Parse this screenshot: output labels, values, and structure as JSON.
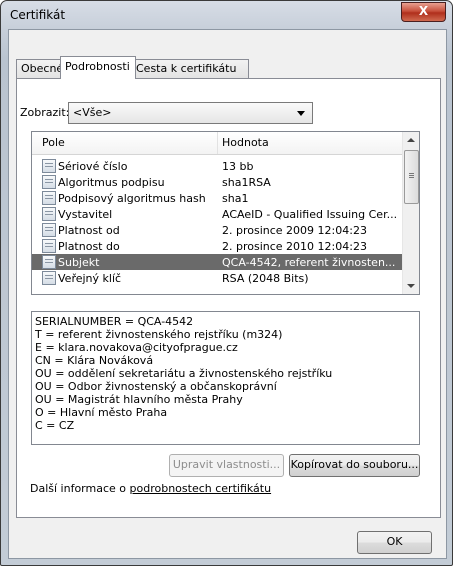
{
  "window": {
    "title": "Certifikát",
    "close_label": "X"
  },
  "tabs": [
    {
      "label": "Obecné",
      "active": false
    },
    {
      "label": "Podrobnosti",
      "active": true
    },
    {
      "label": "Cesta k certifikátu",
      "active": false
    }
  ],
  "show": {
    "label": "Zobrazit:",
    "value": "<Vše>"
  },
  "list": {
    "columns": [
      "Pole",
      "Hodnota"
    ],
    "rows": [
      {
        "field": "Sériové číslo",
        "value": "13 bb"
      },
      {
        "field": "Algoritmus podpisu",
        "value": "sha1RSA"
      },
      {
        "field": "Podpisový algoritmus hash",
        "value": "sha1"
      },
      {
        "field": "Vystavitel",
        "value": "ACAeID - Qualified Issuing Cer..."
      },
      {
        "field": "Platnost od",
        "value": "2. prosince 2009 12:04:23"
      },
      {
        "field": "Platnost do",
        "value": "2. prosince 2010 12:04:23"
      },
      {
        "field": "Subjekt",
        "value": "QCA-4542, referent živnosten..."
      },
      {
        "field": "Veřejný klíč",
        "value": "RSA (2048 Bits)"
      }
    ],
    "selected_index": 6
  },
  "detail_lines": [
    "SERIALNUMBER = QCA-4542",
    "T = referent živnostenského rejstříku (m324)",
    "E = klara.novakova@cityofprague.cz",
    "CN = Klára Nováková",
    "OU = oddělení sekretariátu a živnostenského rejstříku",
    "OU = Odbor živnostenský a občanskoprávní",
    "OU = Magistrát hlavního města Prahy",
    "O = Hlavní město Praha",
    "C = CZ"
  ],
  "buttons": {
    "edit_properties": "Upravit vlastnosti...",
    "copy_to_file": "Kopírovat do souboru...",
    "ok": "OK"
  },
  "more_info": {
    "prefix": "Další informace o ",
    "link": "podrobnostech certifikátu"
  }
}
